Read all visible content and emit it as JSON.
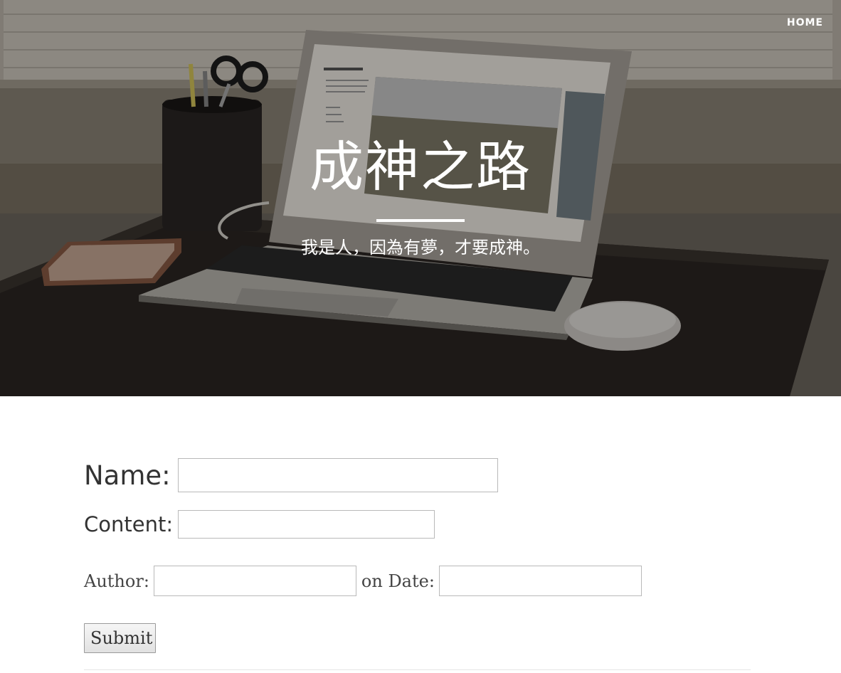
{
  "nav": {
    "home_label": "HOME"
  },
  "header": {
    "title": "成神之路",
    "subtitle": "我是人，因為有夢，才要成神。"
  },
  "form": {
    "name_label": "Name:",
    "name_value": "",
    "content_label": "Content:",
    "content_value": "",
    "author_label": "Author:",
    "author_value": "",
    "date_label": "on Date:",
    "date_value": "",
    "submit_label": "Submit"
  },
  "colors": {
    "hero_overlay": "#000000",
    "text_light": "#ffffff",
    "text_dark": "#333333",
    "input_border": "#b9b9b9"
  }
}
